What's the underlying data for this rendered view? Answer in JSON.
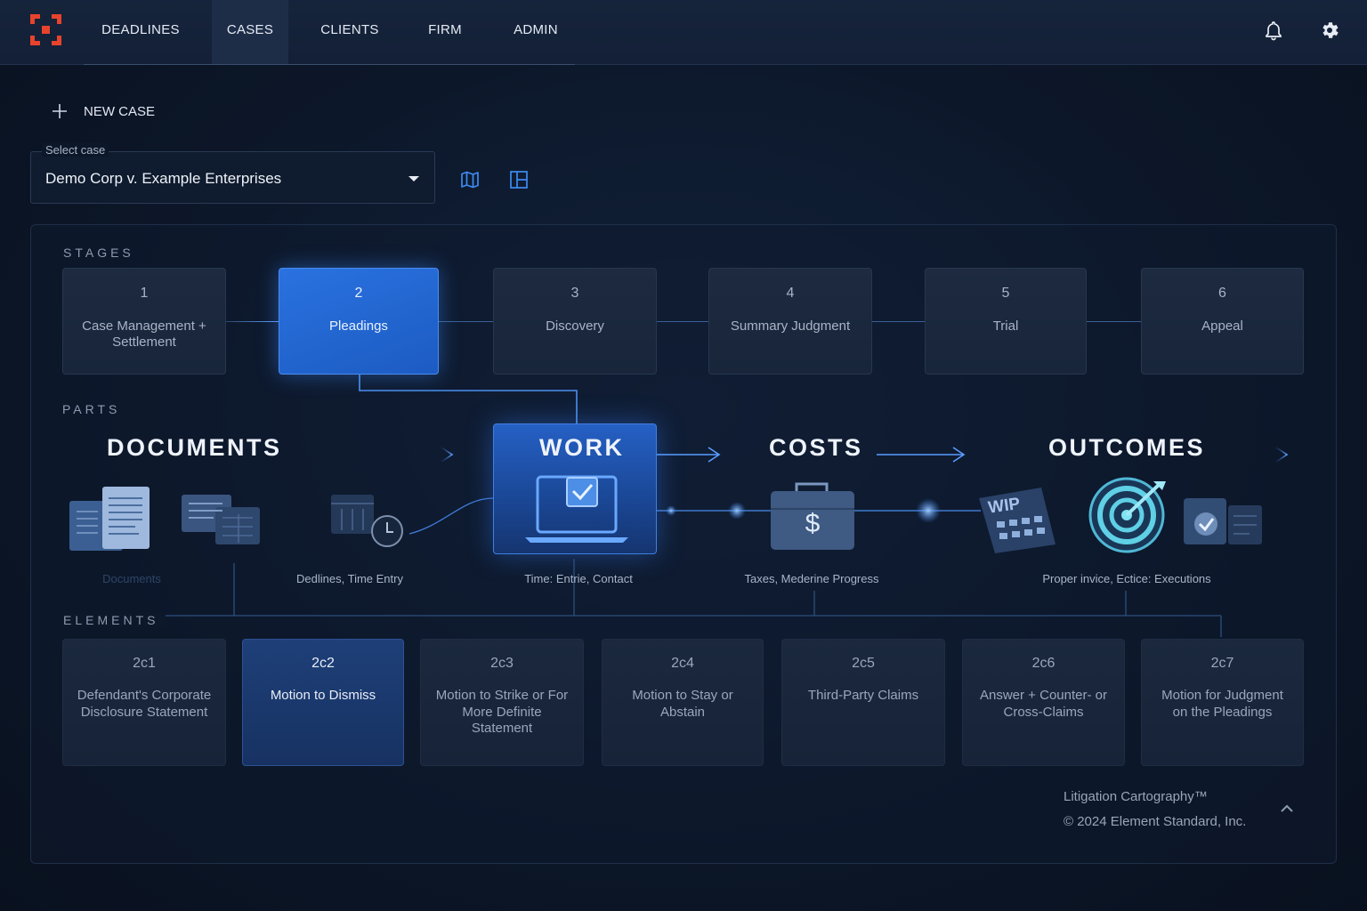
{
  "nav": {
    "logo": "element-standard-logo",
    "items": [
      "DEADLINES",
      "CASES",
      "CLIENTS",
      "FIRM",
      "ADMIN"
    ],
    "active": "CASES",
    "icons": [
      "bell-icon",
      "gear-icon"
    ]
  },
  "toolbar": {
    "new_case_label": "NEW CASE"
  },
  "case_select": {
    "label": "Select case",
    "value": "Demo Corp v. Example Enterprises"
  },
  "view_icons": [
    "map-icon",
    "layout-icon"
  ],
  "stages": {
    "heading": "STAGES",
    "items": [
      {
        "num": "1",
        "label": "Case Management + Settlement"
      },
      {
        "num": "2",
        "label": "Pleadings"
      },
      {
        "num": "3",
        "label": "Discovery"
      },
      {
        "num": "4",
        "label": "Summary Judgment"
      },
      {
        "num": "5",
        "label": "Trial"
      },
      {
        "num": "6",
        "label": "Appeal"
      }
    ],
    "active_index": 1
  },
  "parts": {
    "heading": "PARTS",
    "items": [
      {
        "title": "DOCUMENTS",
        "caption": "Documents"
      },
      {
        "title": "",
        "caption": "Dedlines, Time Entry"
      },
      {
        "title": "WORK",
        "caption": "Time: Entrie, Contact"
      },
      {
        "title": "COSTS",
        "caption": "Taxes, Mederine Progress"
      },
      {
        "title": "OUTCOMES",
        "caption": "Proper invice, Ectice: Executions"
      }
    ],
    "badge": "WIP"
  },
  "elements": {
    "heading": "ELEMENTS",
    "items": [
      {
        "num": "2c1",
        "label": "Defendant's Corporate Disclosure Statement"
      },
      {
        "num": "2c2",
        "label": "Motion to Dismiss"
      },
      {
        "num": "2c3",
        "label": "Motion to Strike or For More Definite Statement"
      },
      {
        "num": "2c4",
        "label": "Motion to Stay or Abstain"
      },
      {
        "num": "2c5",
        "label": "Third-Party Claims"
      },
      {
        "num": "2c6",
        "label": "Answer + Counter- or Cross-Claims"
      },
      {
        "num": "2c7",
        "label": "Motion for Judgment on the Pleadings"
      }
    ],
    "active_index": 1
  },
  "footer": {
    "product": "Litigation Cartography™",
    "copyright": "© 2024 Element Standard, Inc."
  },
  "colors": {
    "accent": "#2a72e0",
    "logo": "#e8432c",
    "background": "#0c1729"
  }
}
